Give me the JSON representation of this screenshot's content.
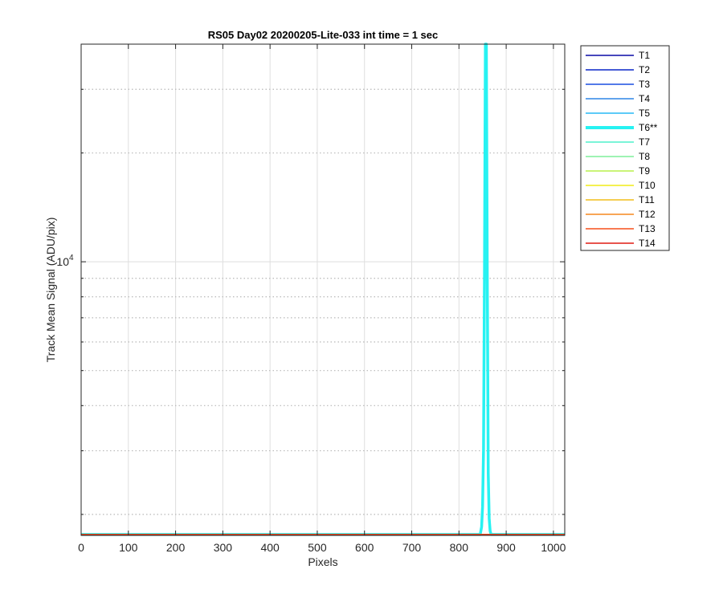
{
  "chart_data": {
    "type": "line",
    "title": "RS05 Day02 20200205-Lite-033 int time = 1 sec",
    "xlabel": "Pixels",
    "ylabel": "Track Mean Signal (ADU/pix)",
    "xlim": [
      0,
      1024
    ],
    "ylim": [
      1750,
      40000
    ],
    "yscale": "log",
    "grid": true,
    "x_ticks": [
      0,
      100,
      200,
      300,
      400,
      500,
      600,
      700,
      800,
      900,
      1000
    ],
    "x_tick_labels": [
      "0",
      "100",
      "200",
      "300",
      "400",
      "500",
      "600",
      "700",
      "800",
      "900",
      "1000"
    ],
    "y_major_ticks": [
      10000
    ],
    "y_tick_labels": [
      {
        "base": "10",
        "exp": "4"
      }
    ],
    "y_minor_ticks": [
      2000,
      3000,
      4000,
      5000,
      6000,
      7000,
      8000,
      9000,
      20000,
      30000
    ],
    "legend_position": "outside-right",
    "series": [
      {
        "name": "T1",
        "color": "#0a0aa6",
        "baseline": 1760
      },
      {
        "name": "T2",
        "color": "#0a27c8",
        "baseline": 1760
      },
      {
        "name": "T3",
        "color": "#1a4fe0",
        "baseline": 1760
      },
      {
        "name": "T4",
        "color": "#2f86e6",
        "baseline": 1760
      },
      {
        "name": "T5",
        "color": "#27b9f5",
        "baseline": 1760
      },
      {
        "name": "T6**",
        "color": "#27f2f2",
        "baseline": 1760,
        "highlight": true,
        "peak": {
          "x": [
            845,
            848,
            850,
            852,
            854,
            856,
            858,
            860,
            862,
            864,
            866,
            868
          ],
          "y": [
            1760,
            1850,
            2100,
            3000,
            9000,
            40000,
            40000,
            9000,
            2600,
            1950,
            1800,
            1760
          ]
        }
      },
      {
        "name": "T7",
        "color": "#4ef0cc",
        "baseline": 1760
      },
      {
        "name": "T8",
        "color": "#7eef9a",
        "baseline": 1760
      },
      {
        "name": "T9",
        "color": "#b8f04a",
        "baseline": 1760
      },
      {
        "name": "T10",
        "color": "#f0ec16",
        "baseline": 1760
      },
      {
        "name": "T11",
        "color": "#f2be1a",
        "baseline": 1760
      },
      {
        "name": "T12",
        "color": "#f5891e",
        "baseline": 1760
      },
      {
        "name": "T13",
        "color": "#f54e1a",
        "baseline": 1760
      },
      {
        "name": "T14",
        "color": "#e01b12",
        "baseline": 1760
      }
    ]
  }
}
